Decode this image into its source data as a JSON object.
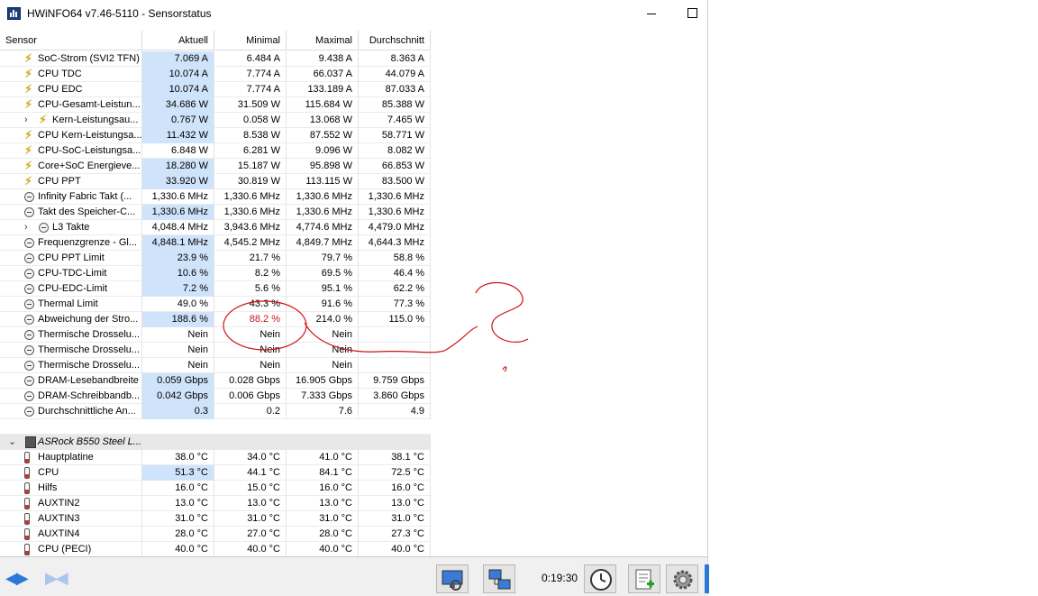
{
  "window": {
    "title": "HWiNFO64 v7.46-5110 - Sensorstatus"
  },
  "columns": {
    "sensor": "Sensor",
    "current": "Aktuell",
    "min": "Minimal",
    "max": "Maximal",
    "avg": "Durchschnitt"
  },
  "rows": [
    {
      "icon": "bolt",
      "name": "SoC-Strom (SVI2 TFN)",
      "cur": "7.069 A",
      "min": "6.484 A",
      "max": "9.438 A",
      "avg": "8.363 A",
      "hl": true
    },
    {
      "icon": "bolt",
      "name": "CPU TDC",
      "cur": "10.074 A",
      "min": "7.774 A",
      "max": "66.037 A",
      "avg": "44.079 A",
      "hl": true
    },
    {
      "icon": "bolt",
      "name": "CPU EDC",
      "cur": "10.074 A",
      "min": "7.774 A",
      "max": "133.189 A",
      "avg": "87.033 A",
      "hl": true
    },
    {
      "icon": "bolt",
      "name": "CPU-Gesamt-Leistun...",
      "cur": "34.686 W",
      "min": "31.509 W",
      "max": "115.684 W",
      "avg": "85.388 W",
      "hl": true
    },
    {
      "icon": "bolt",
      "name": "Kern-Leistungsau...",
      "cur": "0.767 W",
      "min": "0.058 W",
      "max": "13.068 W",
      "avg": "7.465 W",
      "hl": true,
      "expand": true
    },
    {
      "icon": "bolt",
      "name": "CPU Kern-Leistungsa...",
      "cur": "11.432 W",
      "min": "8.538 W",
      "max": "87.552 W",
      "avg": "58.771 W",
      "hl": true
    },
    {
      "icon": "bolt",
      "name": "CPU-SoC-Leistungsa...",
      "cur": "6.848 W",
      "min": "6.281 W",
      "max": "9.096 W",
      "avg": "8.082 W",
      "hl": false
    },
    {
      "icon": "bolt",
      "name": "Core+SoC Energieve...",
      "cur": "18.280 W",
      "min": "15.187 W",
      "max": "95.898 W",
      "avg": "66.853 W",
      "hl": true
    },
    {
      "icon": "bolt",
      "name": "CPU PPT",
      "cur": "33.920 W",
      "min": "30.819 W",
      "max": "113.115 W",
      "avg": "83.500 W",
      "hl": true
    },
    {
      "icon": "clock",
      "name": "Infinity Fabric Takt (...",
      "cur": "1,330.6 MHz",
      "min": "1,330.6 MHz",
      "max": "1,330.6 MHz",
      "avg": "1,330.6 MHz",
      "hl": false
    },
    {
      "icon": "clock",
      "name": "Takt des Speicher-C...",
      "cur": "1,330.6 MHz",
      "min": "1,330.6 MHz",
      "max": "1,330.6 MHz",
      "avg": "1,330.6 MHz",
      "hl": true
    },
    {
      "icon": "clock",
      "name": "L3 Takte",
      "cur": "4,048.4 MHz",
      "min": "3,943.6 MHz",
      "max": "4,774.6 MHz",
      "avg": "4,479.0 MHz",
      "hl": false,
      "expand": true
    },
    {
      "icon": "clock",
      "name": "Frequenzgrenze - Gl...",
      "cur": "4,848.1 MHz",
      "min": "4,545.2 MHz",
      "max": "4,849.7 MHz",
      "avg": "4,644.3 MHz",
      "hl": true
    },
    {
      "icon": "clock",
      "name": "CPU PPT Limit",
      "cur": "23.9 %",
      "min": "21.7 %",
      "max": "79.7 %",
      "avg": "58.8 %",
      "hl": true
    },
    {
      "icon": "clock",
      "name": "CPU-TDC-Limit",
      "cur": "10.6 %",
      "min": "8.2 %",
      "max": "69.5 %",
      "avg": "46.4 %",
      "hl": true
    },
    {
      "icon": "clock",
      "name": "CPU-EDC-Limit",
      "cur": "7.2 %",
      "min": "5.6 %",
      "max": "95.1 %",
      "avg": "62.2 %",
      "hl": true
    },
    {
      "icon": "clock",
      "name": "Thermal Limit",
      "cur": "49.0 %",
      "min": "43.3 %",
      "max": "91.6 %",
      "avg": "77.3 %",
      "hl": false
    },
    {
      "icon": "clock",
      "name": "Abweichung der Stro...",
      "cur": "188.6 %",
      "min": "88.2 %",
      "max": "214.0 %",
      "avg": "115.0 %",
      "hl": true,
      "minRed": true
    },
    {
      "icon": "clock",
      "name": "Thermische Drosselu...",
      "cur": "Nein",
      "min": "Nein",
      "max": "Nein",
      "avg": "",
      "hl": false
    },
    {
      "icon": "clock",
      "name": "Thermische Drosselu...",
      "cur": "Nein",
      "min": "Nein",
      "max": "Nein",
      "avg": "",
      "hl": false
    },
    {
      "icon": "clock",
      "name": "Thermische Drosselu...",
      "cur": "Nein",
      "min": "Nein",
      "max": "Nein",
      "avg": "",
      "hl": false
    },
    {
      "icon": "clock",
      "name": "DRAM-Lesebandbreite",
      "cur": "0.059 Gbps",
      "min": "0.028 Gbps",
      "max": "16.905 Gbps",
      "avg": "9.759 Gbps",
      "hl": true
    },
    {
      "icon": "clock",
      "name": "DRAM-Schreibbandb...",
      "cur": "0.042 Gbps",
      "min": "0.006 Gbps",
      "max": "7.333 Gbps",
      "avg": "3.860 Gbps",
      "hl": true
    },
    {
      "icon": "clock",
      "name": "Durchschnittliche An...",
      "cur": "0.3",
      "min": "0.2",
      "max": "7.6",
      "avg": "4.9",
      "hl": true
    }
  ],
  "group": {
    "name": "ASRock B550 Steel L..."
  },
  "group_rows": [
    {
      "icon": "therm",
      "name": "Hauptplatine",
      "cur": "38.0 °C",
      "min": "34.0 °C",
      "max": "41.0 °C",
      "avg": "38.1 °C",
      "hl": false
    },
    {
      "icon": "therm",
      "name": "CPU",
      "cur": "51.3 °C",
      "min": "44.1 °C",
      "max": "84.1 °C",
      "avg": "72.5 °C",
      "hl": true
    },
    {
      "icon": "therm",
      "name": "Hilfs",
      "cur": "16.0 °C",
      "min": "15.0 °C",
      "max": "16.0 °C",
      "avg": "16.0 °C",
      "hl": false
    },
    {
      "icon": "therm",
      "name": "AUXTIN2",
      "cur": "13.0 °C",
      "min": "13.0 °C",
      "max": "13.0 °C",
      "avg": "13.0 °C",
      "hl": false
    },
    {
      "icon": "therm",
      "name": "AUXTIN3",
      "cur": "31.0 °C",
      "min": "31.0 °C",
      "max": "31.0 °C",
      "avg": "31.0 °C",
      "hl": false
    },
    {
      "icon": "therm",
      "name": "AUXTIN4",
      "cur": "28.0 °C",
      "min": "27.0 °C",
      "max": "28.0 °C",
      "avg": "27.3 °C",
      "hl": false
    },
    {
      "icon": "therm",
      "name": "CPU (PECI)",
      "cur": "40.0 °C",
      "min": "40.0 °C",
      "max": "40.0 °C",
      "avg": "40.0 °C",
      "hl": false
    }
  ],
  "toolbar": {
    "timer": "0:19:30"
  },
  "colors": {
    "highlight": "#cfe3fb",
    "annotation": "#d01010",
    "accent": "#2c78d8"
  },
  "icons": [
    "bolt-icon",
    "clock-icon",
    "thermometer-icon",
    "chip-icon",
    "nav-arrows-icon",
    "monitor-icon",
    "network-icon",
    "timer-clock-icon",
    "report-icon",
    "settings-gear-icon"
  ]
}
